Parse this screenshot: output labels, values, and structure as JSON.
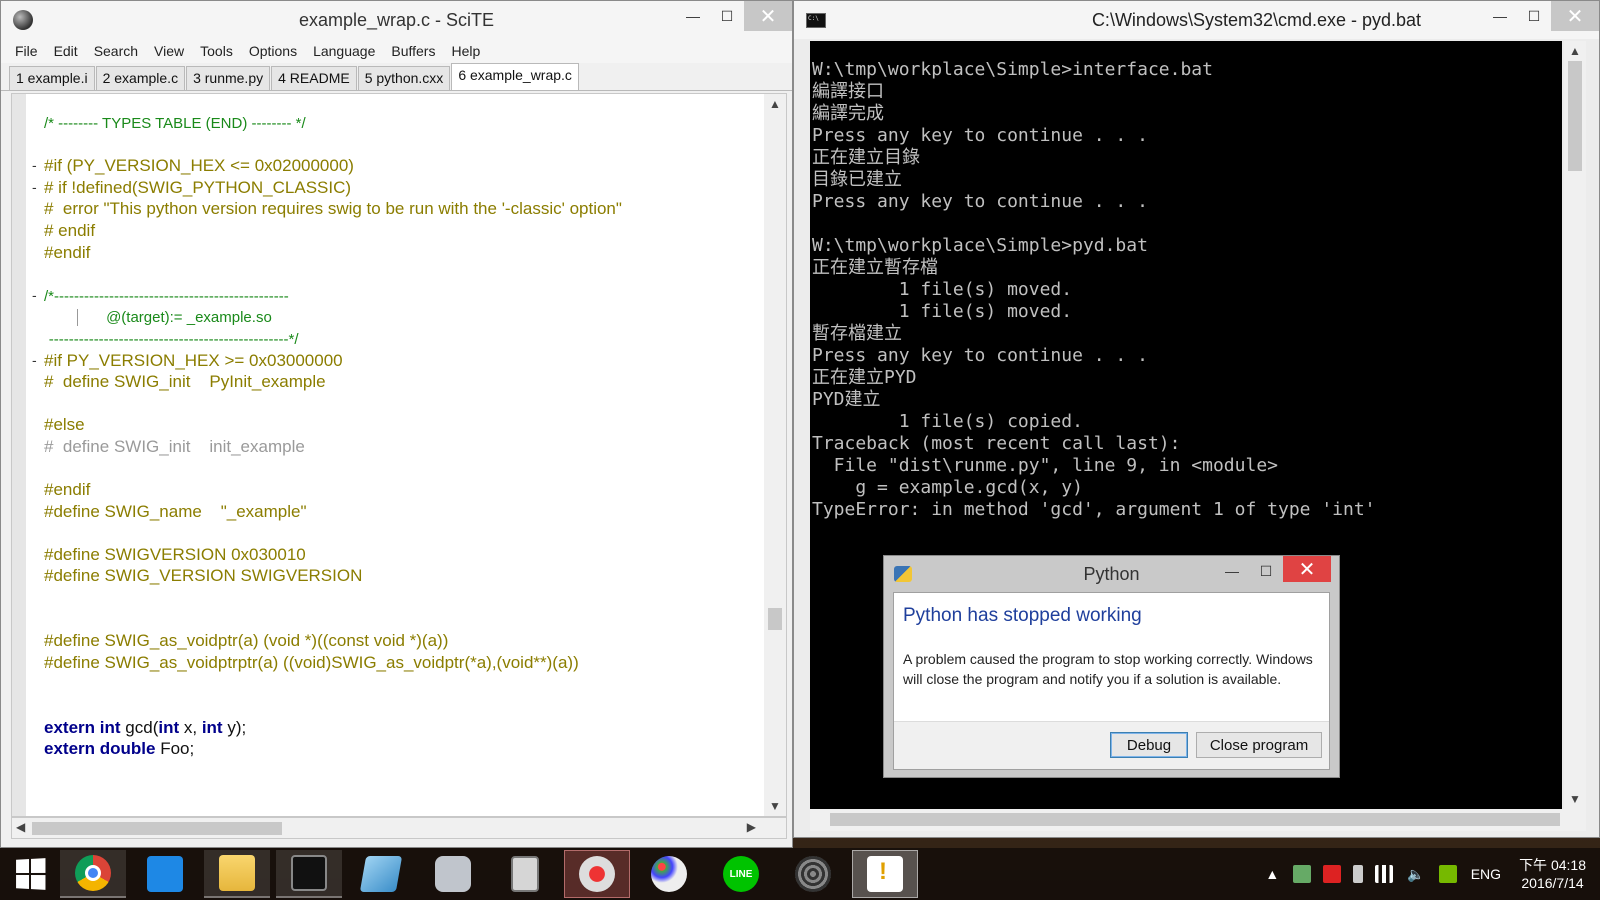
{
  "scite": {
    "title": "example_wrap.c - SciTE",
    "menu": [
      "File",
      "Edit",
      "Search",
      "View",
      "Tools",
      "Options",
      "Language",
      "Buffers",
      "Help"
    ],
    "tabs": [
      "1 example.i",
      "2 example.c",
      "3 runme.py",
      "4 README",
      "5 python.cxx",
      "6 example_wrap.c"
    ],
    "active_tab": "6 example_wrap.c",
    "code": {
      "l1": "/* -------- TYPES TABLE (END) -------- */",
      "l3": "#if (PY_VERSION_HEX <= 0x02000000)",
      "l4": "# if !defined(SWIG_PYTHON_CLASSIC)",
      "l5": "#  error \"This python version requires swig to be run with the '-classic' option\"",
      "l6": "# endif",
      "l7": "#endif",
      "l9": "/*-----------------------------------------------",
      "l10": "@(target):= _example.so",
      "l11": "------------------------------------------------*/",
      "l12": "#if PY_VERSION_HEX >= 0x03000000",
      "l13": "#  define SWIG_init    PyInit_example",
      "l15": "#else",
      "l16": "#  define SWIG_init    init_example",
      "l18": "#endif",
      "l19": "#define SWIG_name    \"_example\"",
      "l21": "#define SWIGVERSION 0x030010",
      "l22": "#define SWIG_VERSION SWIGVERSION",
      "l25": "#define SWIG_as_voidptr(a) (void *)((const void *)(a))",
      "l26": "#define SWIG_as_voidptrptr(a) ((void)SWIG_as_voidptr(*a),(void**)(a))",
      "l29_kw1": "extern",
      "l29_kw2": "int",
      "l29_fn": "gcd(",
      "l29_kw3": "int",
      "l29_x": "x, ",
      "l29_kw4": "int",
      "l29_y": "y);",
      "l30_kw1": "extern",
      "l30_kw2": "double",
      "l30_rest": "Foo;"
    }
  },
  "cmd": {
    "title": "C:\\Windows\\System32\\cmd.exe - pyd.bat",
    "lines": [
      "W:\\tmp\\workplace\\Simple>interface.bat",
      "編譯接口",
      "編譯完成",
      "Press any key to continue . . .",
      "正在建立目錄",
      "目錄已建立",
      "Press any key to continue . . .",
      "",
      "W:\\tmp\\workplace\\Simple>pyd.bat",
      "正在建立暫存檔",
      "        1 file(s) moved.",
      "        1 file(s) moved.",
      "暫存檔建立",
      "Press any key to continue . . .",
      "正在建立PYD",
      "PYD建立",
      "        1 file(s) copied.",
      "Traceback (most recent call last):",
      "  File \"dist\\runme.py\", line 9, in <module>",
      "    g = example.gcd(x, y)",
      "TypeError: in method 'gcd', argument 1 of type 'int'"
    ]
  },
  "dialog": {
    "title": "Python",
    "heading": "Python has stopped working",
    "message": "A problem caused the program to stop working correctly. Windows will close the program and notify you if a solution is available.",
    "debug_label": "Debug",
    "close_label": "Close program"
  },
  "taskbar": {
    "items": [
      "chrome-icon",
      "media-player-icon",
      "file-explorer-icon",
      "cmd-icon",
      "notepad-icon",
      "camera-icon",
      "calculator-icon",
      "snipping-tool-icon",
      "paint-icon",
      "line-icon",
      "scite-icon",
      "warning-icon"
    ],
    "line_label": "LINE",
    "lang": "ENG",
    "time": "下午 04:18",
    "date": "2016/7/14"
  },
  "window_controls": {
    "minimize": "—",
    "maximize": "☐",
    "close": "✕"
  }
}
